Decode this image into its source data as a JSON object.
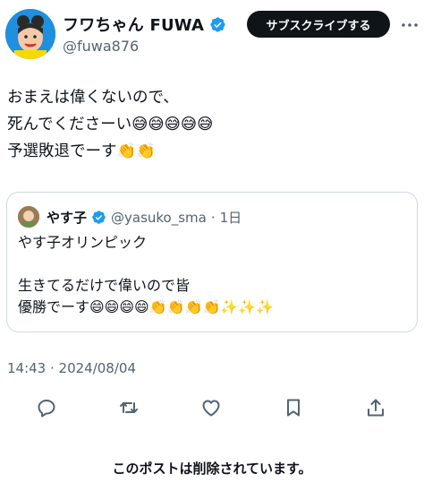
{
  "author": {
    "display_name": "フワちゃん FUWA",
    "handle": "@fuwa876",
    "verified_icon": "verified-badge-icon",
    "avatar_color": "#1f8fe0"
  },
  "header": {
    "subscribe_label": "サブスクライブする",
    "more_icon": "more-icon"
  },
  "tweet": {
    "lines": [
      "おまえは偉くないので、",
      "死んでくださーい😅😅😅😅😅",
      "予選敗退でーす👏👏"
    ]
  },
  "quoted_tweet": {
    "display_name": "やす子",
    "handle": "@yasuko_sma",
    "separator": "·",
    "time": "1日",
    "lines": [
      "やす子オリンピック",
      "",
      "生きてるだけで偉いので皆",
      "優勝でーす😄😄😄😄👏👏👏👏✨✨✨"
    ]
  },
  "timestamp": "14:43 · 2024/08/04",
  "actions": {
    "reply_icon": "reply-icon",
    "retweet_icon": "retweet-icon",
    "like_icon": "like-icon",
    "bookmark_icon": "bookmark-icon",
    "share_icon": "share-icon"
  },
  "footer": {
    "deleted_notice": "このポストは削除されています。"
  },
  "colors": {
    "text": "#0f1419",
    "secondary": "#536471",
    "border": "#cfd9de",
    "verified": "#1d9bf0",
    "button_bg": "#0f1419"
  }
}
